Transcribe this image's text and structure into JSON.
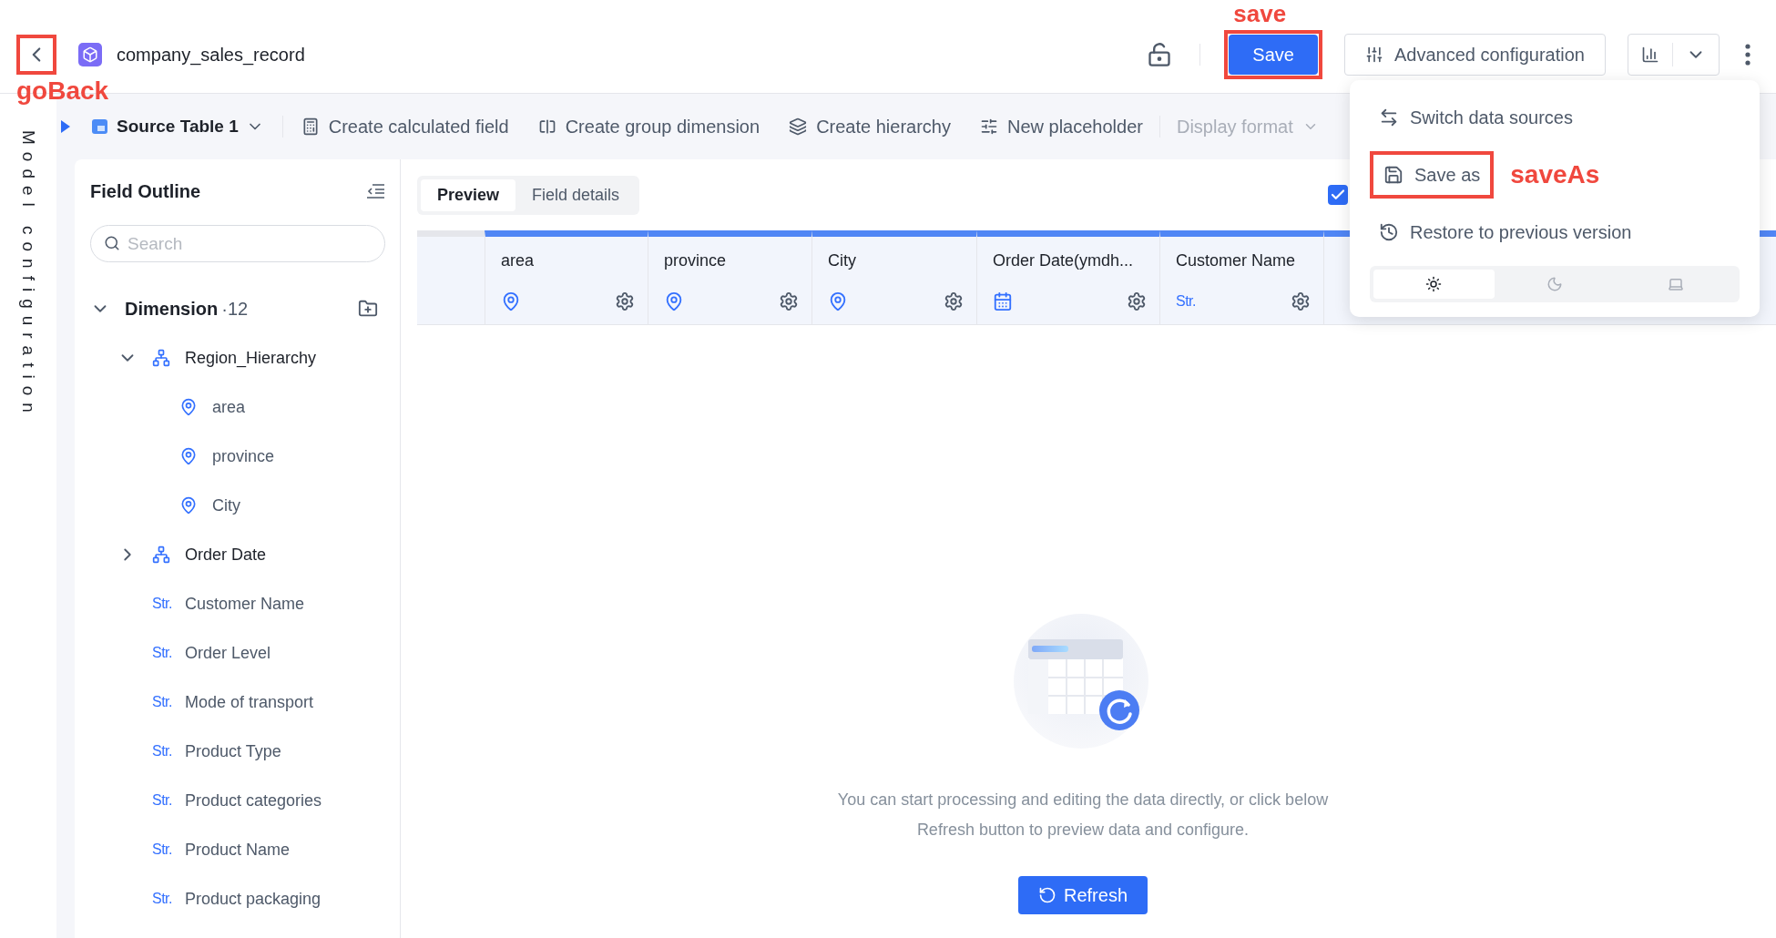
{
  "header": {
    "back_button": {
      "annotation": "goBack"
    },
    "title": "company_sales_record",
    "locked": false,
    "save_button": {
      "label": "Save",
      "annotation": "save"
    },
    "advanced_button": {
      "label": "Advanced configuration"
    }
  },
  "side_rail": {
    "label": "Model configuration"
  },
  "toolbar": {
    "source": {
      "label": "Source Table 1"
    },
    "items": [
      {
        "kind": "calculated",
        "label": "Create calculated field",
        "disabled": false
      },
      {
        "kind": "group",
        "label": "Create group dimension",
        "disabled": false
      },
      {
        "kind": "hierarchy",
        "label": "Create hierarchy",
        "disabled": false
      },
      {
        "kind": "placeholder",
        "label": "New placeholder",
        "disabled": false
      },
      {
        "kind": "format",
        "label": "Display format",
        "disabled": true
      }
    ]
  },
  "field_outline": {
    "title": "Field Outline",
    "search": {
      "placeholder": "Search"
    },
    "groups": [
      {
        "label": "Dimension",
        "count": "·12",
        "expanded": true,
        "children": [
          {
            "label": "Region_Hierarchy",
            "kind": "hierarchy",
            "expanded": true,
            "children": [
              {
                "label": "area",
                "kind": "geo"
              },
              {
                "label": "province",
                "kind": "geo"
              },
              {
                "label": "City",
                "kind": "geo"
              }
            ]
          },
          {
            "label": "Order Date",
            "kind": "hierarchy",
            "expanded": false
          },
          {
            "label": "Customer Name",
            "kind": "string",
            "badge": "Str."
          },
          {
            "label": "Order Level",
            "kind": "string",
            "badge": "Str."
          },
          {
            "label": "Mode of transport",
            "kind": "string",
            "badge": "Str."
          },
          {
            "label": "Product Type",
            "kind": "string",
            "badge": "Str."
          },
          {
            "label": "Product categories",
            "kind": "string",
            "badge": "Str."
          },
          {
            "label": "Product Name",
            "kind": "string",
            "badge": "Str."
          },
          {
            "label": "Product packaging",
            "kind": "string",
            "badge": "Str."
          }
        ]
      }
    ]
  },
  "tabs": [
    {
      "label": "Preview",
      "selected": true
    },
    {
      "label": "Field details",
      "selected": false
    }
  ],
  "checkbox": {
    "checked": true
  },
  "table": {
    "columns": [
      {
        "name": "area",
        "kind": "geo"
      },
      {
        "name": "province",
        "kind": "geo"
      },
      {
        "name": "City",
        "kind": "geo"
      },
      {
        "name": "Order Date(ymdh...",
        "kind": "date"
      },
      {
        "name": "Customer Name",
        "kind": "string",
        "badge": "Str."
      }
    ]
  },
  "empty_state": {
    "message": "You can start processing and editing the data directly, or click below Refresh button to preview data and configure.",
    "button": "Refresh"
  },
  "menu": {
    "items": [
      {
        "kind": "switch",
        "label": "Switch data sources"
      },
      {
        "kind": "save_as",
        "label": "Save as",
        "annotation": "saveAs"
      },
      {
        "kind": "restore",
        "label": "Restore to previous version"
      }
    ],
    "theme_options": [
      {
        "kind": "light",
        "selected": true
      },
      {
        "kind": "dark",
        "selected": false
      },
      {
        "kind": "system",
        "selected": false
      }
    ]
  }
}
